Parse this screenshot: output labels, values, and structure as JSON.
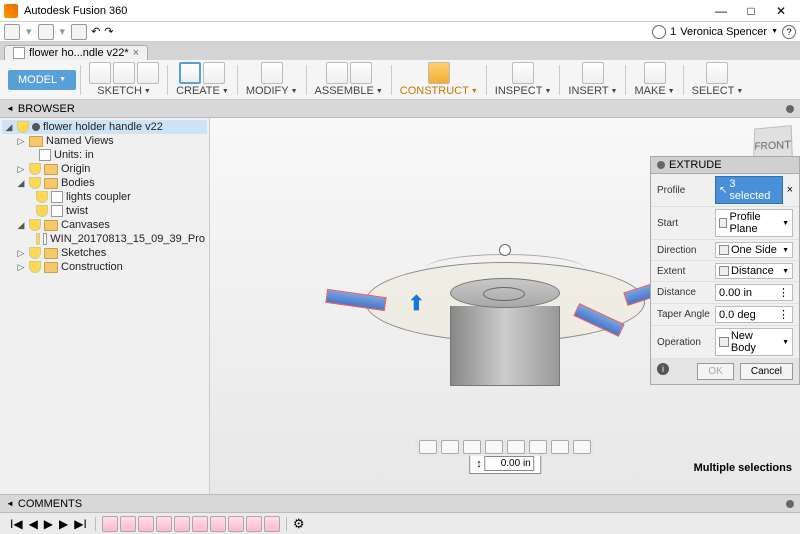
{
  "app": {
    "title": "Autodesk Fusion 360"
  },
  "tab": {
    "name": "flower ho...ndle v22*"
  },
  "user": {
    "name": "Veronica Spencer",
    "notifications": "1"
  },
  "mode": {
    "label": "MODEL"
  },
  "ribbon": {
    "sketch": "SKETCH",
    "create": "CREATE",
    "modify": "MODIFY",
    "assemble": "ASSEMBLE",
    "construct": "CONSTRUCT",
    "inspect": "INSPECT",
    "insert": "INSERT",
    "make": "MAKE",
    "select": "SELECT"
  },
  "browser": {
    "title": "BROWSER",
    "root": "flower holder handle v22",
    "named_views": "Named Views",
    "units": "Units: in",
    "origin": "Origin",
    "bodies": "Bodies",
    "lights_coupler": "lights coupler",
    "twist": "twist",
    "canvases": "Canvases",
    "canvas_item": "WIN_20170813_15_09_39_Pro",
    "sketches": "Sketches",
    "construction": "Construction"
  },
  "viewcube": {
    "face": "FRONT"
  },
  "dimension": {
    "value": "0.00 in"
  },
  "panel": {
    "title": "EXTRUDE",
    "rows": {
      "profile": {
        "label": "Profile",
        "value": "3 selected"
      },
      "start": {
        "label": "Start",
        "value": "Profile Plane"
      },
      "direction": {
        "label": "Direction",
        "value": "One Side"
      },
      "extent": {
        "label": "Extent",
        "value": "Distance"
      },
      "distance": {
        "label": "Distance",
        "value": "0.00 in"
      },
      "taper": {
        "label": "Taper Angle",
        "value": "0.0 deg"
      },
      "operation": {
        "label": "Operation",
        "value": "New Body"
      }
    },
    "ok": "OK",
    "cancel": "Cancel"
  },
  "comments": {
    "label": "COMMENTS"
  },
  "status": {
    "text": "Multiple selections"
  }
}
